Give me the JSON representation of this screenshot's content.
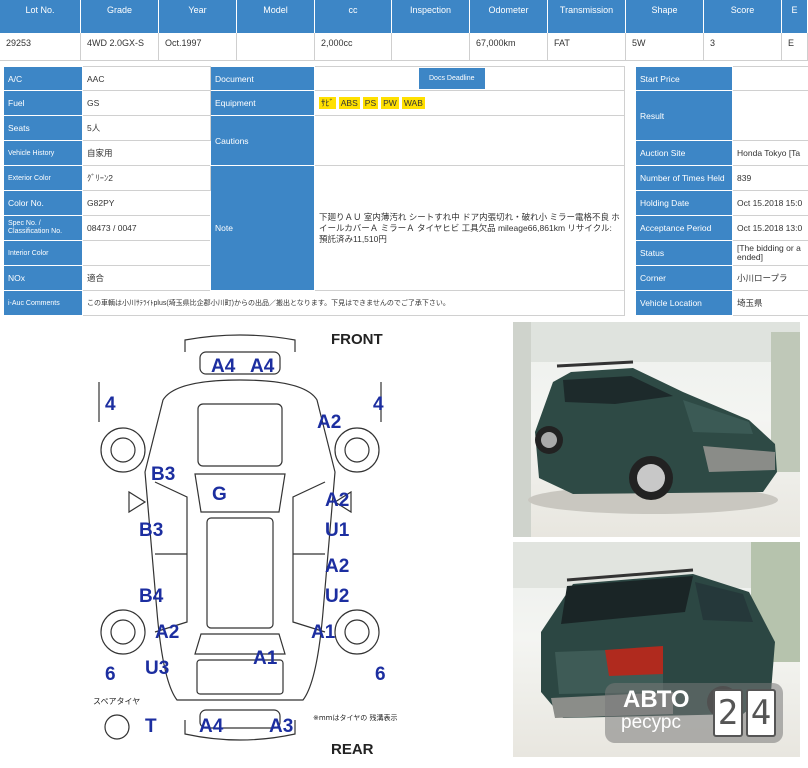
{
  "header": {
    "lot_no": "Lot No.",
    "grade": "Grade",
    "year": "Year",
    "model": "Model",
    "cc": "cc",
    "inspection": "Inspection",
    "odometer": "Odometer",
    "transmission": "Transmission",
    "shape": "Shape",
    "score": "Score",
    "extra": "E"
  },
  "lot": {
    "lot_no": "29253",
    "grade": "4WD 2.0GX-S",
    "year": "Oct.1997",
    "model": "",
    "cc": "2,000cc",
    "inspection": "",
    "odometer": "67,000km",
    "transmission": "FAT",
    "shape": "5W",
    "score": "3",
    "extra": "E"
  },
  "details": {
    "ac_label": "A/C",
    "ac": "AAC",
    "fuel_label": "Fuel",
    "fuel": "GS",
    "seats_label": "Seats",
    "seats": "5人",
    "history_label": "Vehicle History",
    "history": "自家用",
    "ext_color_label": "Exterior Color",
    "ext_color": "ｸﾞﾘｰﾝ2",
    "color_no_label": "Color No.",
    "color_no": "G82PY",
    "spec_label": "Spec No. / Classification No.",
    "spec": "08473 / 0047",
    "int_color_label": "Interior Color",
    "int_color": "",
    "nox_label": "NOx",
    "nox": "適合",
    "comments_label": "i-Auc Comments",
    "comments": "この車輌は小川ｻﾃﾗｲﾄplus(埼玉県比企郡小川町)からの出品／搬出となります。下見はできませんのでご了承下さい。",
    "document_label": "Document",
    "docs_deadline": "Docs Deadline",
    "equipment_label": "Equipment",
    "equipment": [
      "ｻﾋﾞ",
      "ABS",
      "PS",
      "PW",
      "WAB"
    ],
    "cautions_label": "Cautions",
    "note_label": "Note",
    "note": "下廻りＡＵ 室内薄汚れ シートすれ中 ドア内張切れ・破れ小 ミラー電格不良 ホイールカバーＡ ミラーＡ タイヤヒビ 工具欠品 mileage66,861km リサイクル:預託済み11,510円"
  },
  "auction": {
    "start_price_label": "Start Price",
    "start_price": "",
    "result_label": "Result",
    "result": "",
    "site_label": "Auction Site",
    "site": "Honda Tokyo [Ta",
    "times_label": "Number of Times Held",
    "times": "839",
    "holding_label": "Holding Date",
    "holding": "Oct 15.2018 15:0",
    "acceptance_label": "Acceptance Period",
    "acceptance": "Oct 15.2018 13:0",
    "status_label": "Status",
    "status": "[The bidding or a ended]",
    "corner_label": "Corner",
    "corner": "小川ロープラ",
    "location_label": "Vehicle Location",
    "location": "埼玉県"
  },
  "sheet": {
    "front": "FRONT",
    "rear": "REAR",
    "marks": [
      "A4",
      "A4",
      "4",
      "4",
      "A2",
      "B3",
      "G",
      "A2",
      "B3",
      "U1",
      "A2",
      "B4",
      "U2",
      "A2",
      "A1",
      "A1",
      "6",
      "U3",
      "6",
      "T",
      "A4",
      "A3"
    ],
    "spare_label": "スペアタイヤ",
    "tire_note": "※mmはタイヤの 残溝表示です"
  },
  "watermark": {
    "line1": "АВТО",
    "line2": "ресурс",
    "digit1": "2",
    "digit2": "4"
  },
  "colors": {
    "header_blue": "#3d86c6",
    "equipment_yellow": "#ffe000",
    "status_red": "#d02020",
    "diagram_blue": "#1c2ea0"
  }
}
